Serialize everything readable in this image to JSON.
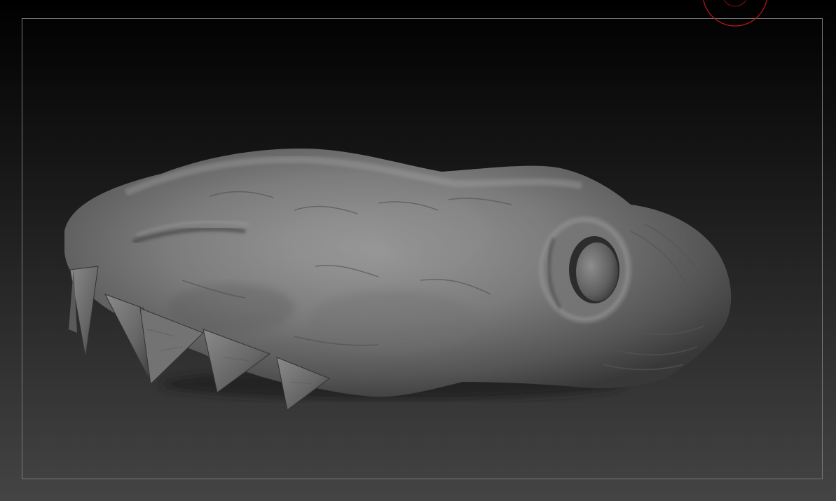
{
  "viewport": {
    "description_visible_text": "",
    "frame_color": "#7a7a7a",
    "background_top": "#000000",
    "background_bottom": "#444444",
    "model_base_color": "#6e6e6e",
    "model_highlight_color": "#9c9c9c",
    "model_shadow_color": "#2a2a2a",
    "brush_cursor_color": "#c01818"
  }
}
